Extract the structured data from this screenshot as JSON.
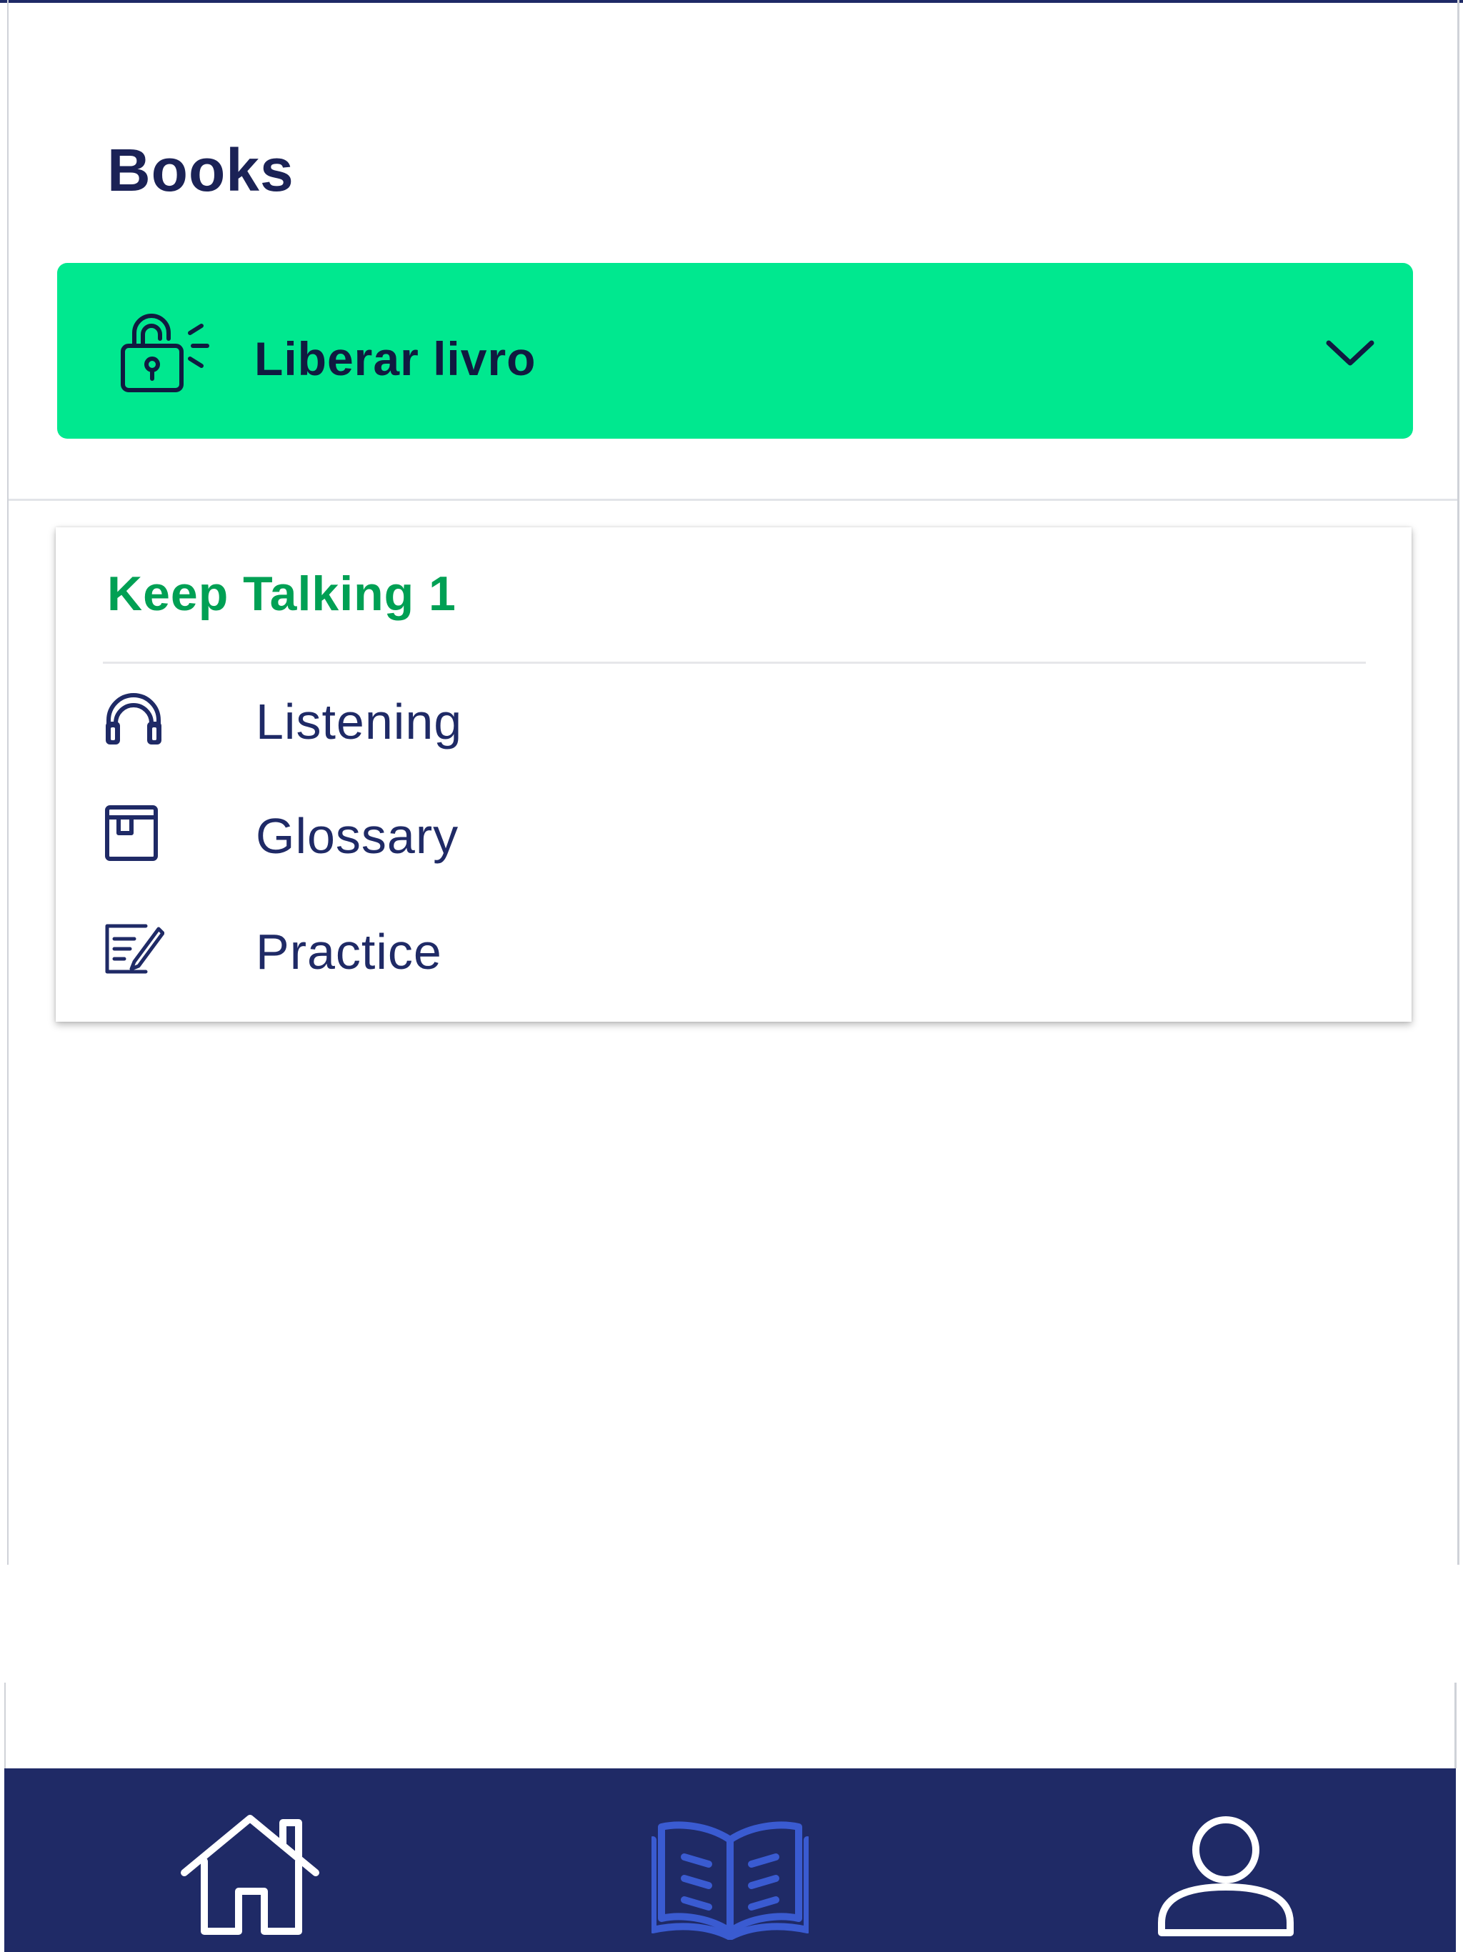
{
  "header": {
    "title": "Books"
  },
  "unlock": {
    "label": "Liberar livro",
    "icon": "unlock-padlock-icon",
    "expand_icon": "chevron-down-icon",
    "color": "#00e88f"
  },
  "book": {
    "title": "Keep Talking 1",
    "title_color": "#00a054",
    "items": [
      {
        "label": "Listening",
        "icon": "headphones-icon"
      },
      {
        "label": "Glossary",
        "icon": "glossary-book-icon"
      },
      {
        "label": "Practice",
        "icon": "practice-edit-icon"
      }
    ]
  },
  "bottom_nav": {
    "background": "#1f2a66",
    "items": [
      {
        "name": "home",
        "icon": "home-icon",
        "active": false
      },
      {
        "name": "books",
        "icon": "open-book-icon",
        "active": true
      },
      {
        "name": "profile",
        "icon": "user-icon",
        "active": false
      }
    ],
    "active_color": "#3a5bd1",
    "inactive_color": "#ffffff"
  }
}
